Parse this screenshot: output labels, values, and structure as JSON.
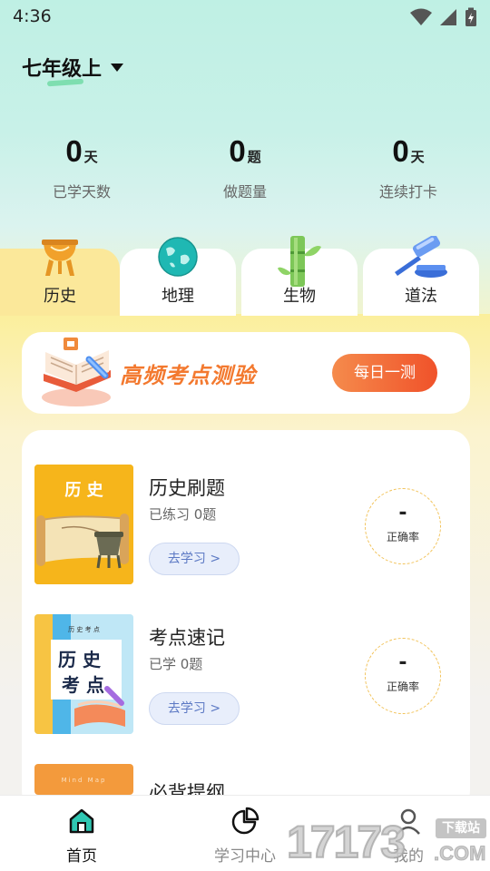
{
  "status_bar": {
    "time": "4:36"
  },
  "header": {
    "grade": "七年级上"
  },
  "stats": [
    {
      "num": "0",
      "unit": "天",
      "desc": "已学天数"
    },
    {
      "num": "0",
      "unit": "题",
      "desc": "做题量"
    },
    {
      "num": "0",
      "unit": "天",
      "desc": "连续打卡"
    }
  ],
  "tabs": [
    {
      "label": "历史",
      "icon": "tripod-vessel-icon",
      "active": true
    },
    {
      "label": "地理",
      "icon": "globe-icon"
    },
    {
      "label": "生物",
      "icon": "bamboo-icon"
    },
    {
      "label": "道法",
      "icon": "gavel-icon"
    }
  ],
  "banner": {
    "title": "高频考点测验",
    "button": "每日一测"
  },
  "items": [
    {
      "title": "历史刷题",
      "sub": "已练习 0题",
      "go": "去学习 >",
      "acc_value": "-",
      "acc_label": "正确率",
      "thumb_text": "历 史"
    },
    {
      "title": "考点速记",
      "sub": "已学 0题",
      "go": "去学习 >",
      "acc_value": "-",
      "acc_label": "正确率",
      "thumb_small": "历 史 考 点",
      "thumb_big1": "历 史",
      "thumb_big2": "考 点"
    },
    {
      "title": "必背提纲",
      "thumb_small": "Mind Map"
    }
  ],
  "bottom_nav": [
    {
      "label": "首页",
      "icon": "home-icon",
      "active": true
    },
    {
      "label": "学习中心",
      "icon": "pie-chart-icon"
    },
    {
      "label": "我的",
      "icon": "user-icon"
    }
  ],
  "watermark": {
    "number": "17173",
    "tag": "下载站",
    "domain": ".COM"
  },
  "colors": {
    "accent": "#f0522a",
    "tab_active": "#fbe89a",
    "link": "#5c79c4"
  }
}
